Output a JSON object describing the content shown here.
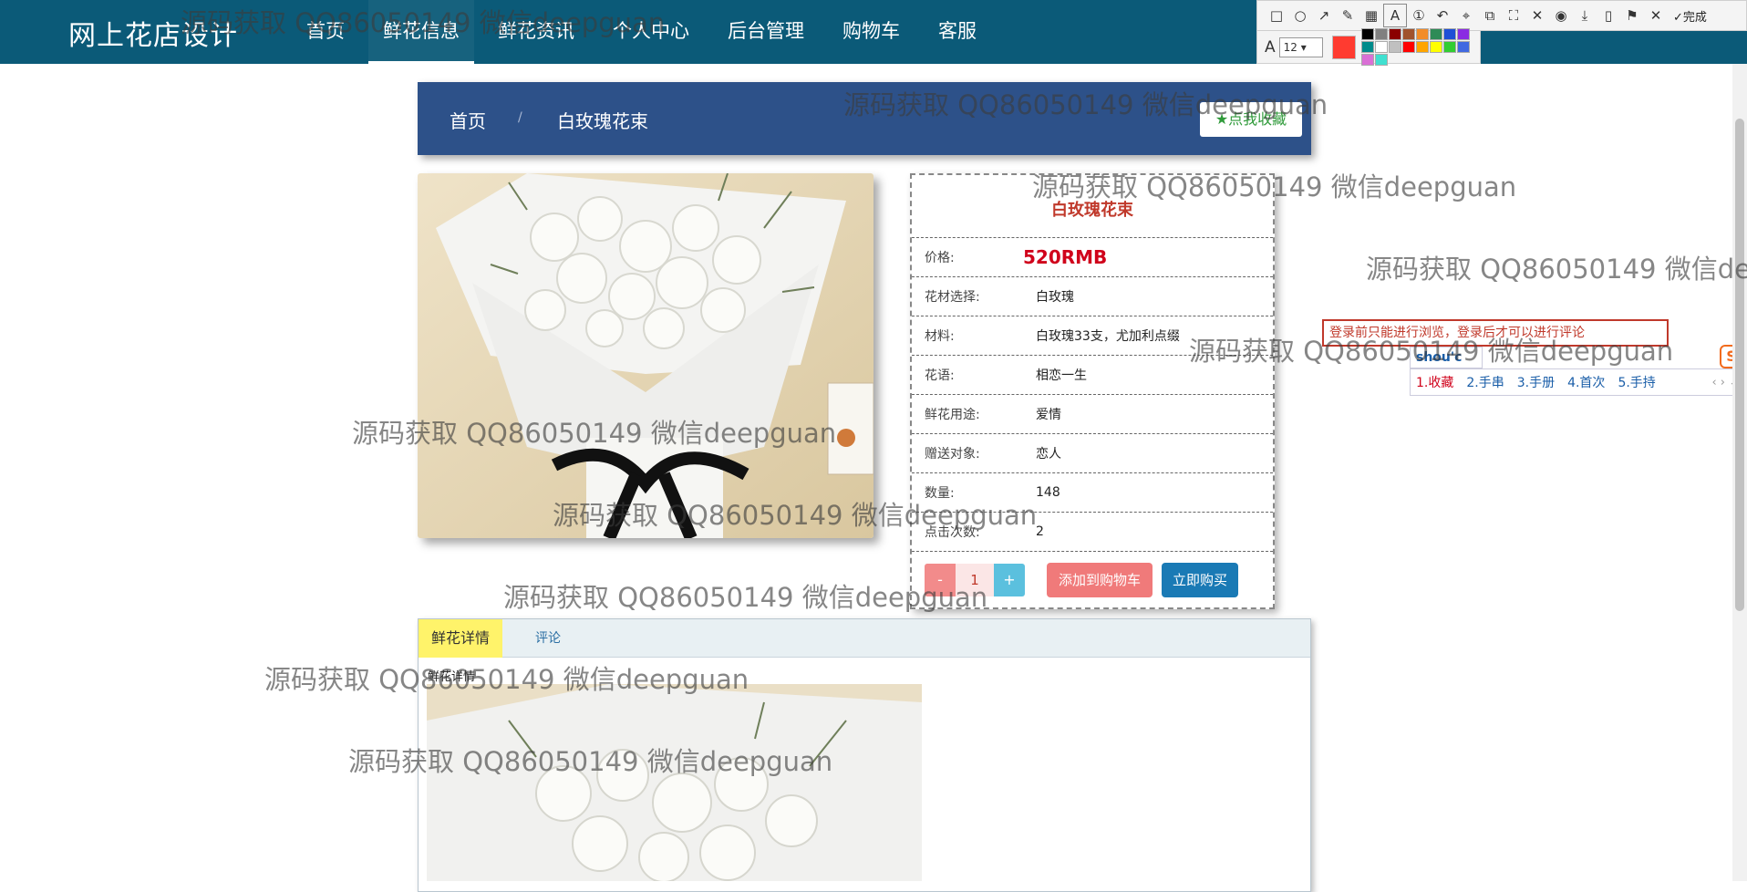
{
  "brand": "网上花店设计",
  "nav": [
    "首页",
    "鲜花信息",
    "鲜花资讯",
    "个人中心",
    "后台管理",
    "购物车",
    "客服"
  ],
  "nav_active": "鲜花信息",
  "toolbar": {
    "tools": [
      "rect-icon",
      "circle-icon",
      "arrow-icon",
      "pen-icon",
      "mosaic-icon",
      "text-icon",
      "number-icon",
      "undo-icon",
      "pin-icon",
      "copy-icon",
      "ocr-icon",
      "translate-icon",
      "record-icon",
      "download-icon",
      "save-icon",
      "bookmark-icon",
      "close-icon"
    ],
    "done_label": "✓完成",
    "font_size": "12",
    "current_color": "#ff3b30",
    "palette": [
      "#000000",
      "#808080",
      "#8b0000",
      "#a0522d",
      "#f28c28",
      "#2e8b57",
      "#1e4fd6",
      "#8a2be2",
      "#008b8b",
      "#ffffff",
      "#c0c0c0",
      "#ff0000",
      "#ffa500",
      "#ffff00",
      "#32cd32",
      "#4169e1",
      "#da70d6",
      "#40e0d0"
    ]
  },
  "breadcrumb": {
    "home": "首页",
    "separator": "/",
    "current": "白玫瑰花束",
    "favorite": "★点我收藏"
  },
  "product": {
    "name": "白玫瑰花束",
    "price_label": "价格:",
    "price": "520RMB",
    "rows": [
      {
        "label": "花材选择:",
        "value": "白玫瑰"
      },
      {
        "label": "材料:",
        "value": "白玫瑰33支，尤加利点缀"
      },
      {
        "label": "花语:",
        "value": "相恋一生"
      },
      {
        "label": "鲜花用途:",
        "value": "爱情"
      },
      {
        "label": "赠送对象:",
        "value": "恋人"
      },
      {
        "label": "数量:",
        "value": "148"
      },
      {
        "label": "点击次数:",
        "value": "2"
      }
    ],
    "qty_minus": "-",
    "qty_value": "1",
    "qty_plus": "+",
    "add_to_cart": "添加到购物车",
    "buy_now": "立即购买"
  },
  "tabs": {
    "details": "鲜花详情",
    "comments": "评论",
    "section_title": "鲜花详情"
  },
  "login_notice": "登录前只能进行浏览，登录后才可以进行评论",
  "ime": {
    "input": "shou'c",
    "candidates": [
      "1.收藏",
      "2.手串",
      "3.手册",
      "4.首次",
      "5.手持"
    ],
    "arrows": "‹ › ⌄",
    "logo": "S"
  },
  "watermark": "源码获取 QQ86050149 微信deepguan"
}
